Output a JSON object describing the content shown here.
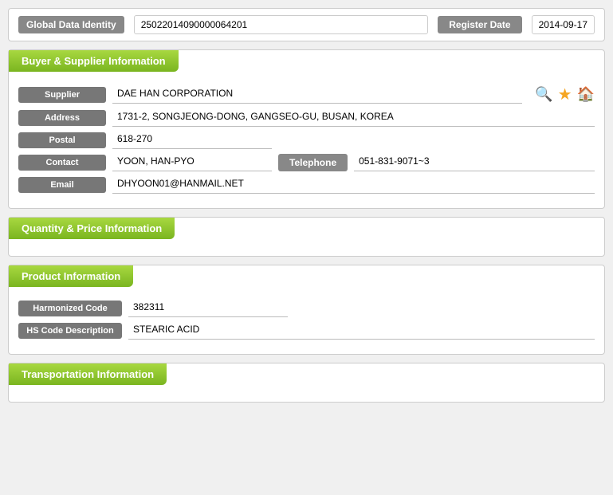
{
  "identity": {
    "label": "Global Data Identity",
    "value": "25022014090000064201",
    "register_btn": "Register Date",
    "register_date": "2014-09-17"
  },
  "buyer_supplier": {
    "title": "Buyer & Supplier Information",
    "supplier_label": "Supplier",
    "supplier_value": "DAE HAN CORPORATION",
    "address_label": "Address",
    "address_value": "1731-2, SONGJEONG-DONG, GANGSEO-GU, BUSAN, KOREA",
    "postal_label": "Postal",
    "postal_value": "618-270",
    "contact_label": "Contact",
    "contact_value": "YOON, HAN-PYO",
    "telephone_btn": "Telephone",
    "telephone_value": "051-831-9071~3",
    "email_label": "Email",
    "email_value": "DHYOON01@HANMAIL.NET"
  },
  "quantity_price": {
    "title": "Quantity & Price Information"
  },
  "product": {
    "title": "Product Information",
    "harmonized_label": "Harmonized Code",
    "harmonized_value": "382311",
    "hs_desc_label": "HS Code Description",
    "hs_desc_value": "STEARIC ACID"
  },
  "transportation": {
    "title": "Transportation Information"
  }
}
